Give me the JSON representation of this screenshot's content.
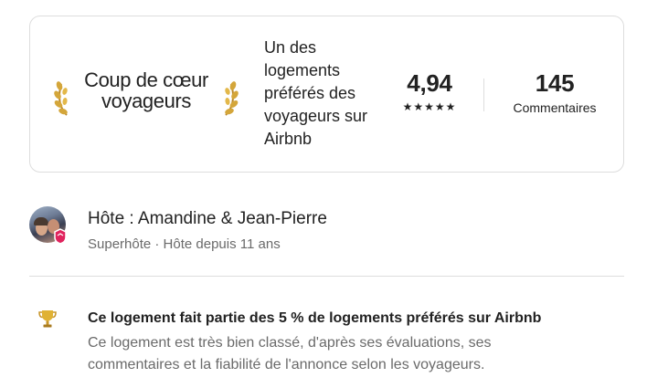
{
  "guest_favorite": {
    "badge_title": "Coup de cœur voyageurs",
    "description": "Un des logements préférés des voyageurs sur Airbnb",
    "rating": "4,94",
    "stars": "★★★★★",
    "reviews_count": "145",
    "reviews_label": "Commentaires"
  },
  "host": {
    "name": "Hôte : Amandine & Jean-Pierre",
    "subtitle": "Superhôte · Hôte depuis 11 ans"
  },
  "highlight": {
    "icon": "trophy-icon",
    "title": "Ce logement fait partie des 5 % de logements préférés sur Airbnb",
    "description": "Ce logement est très bien classé, d'après ses évaluations, ses commentaires et la fiabilité de l'annonce selon les voyageurs."
  },
  "colors": {
    "text_primary": "#222222",
    "text_secondary": "#6a6a6a",
    "border": "#dddddd",
    "laurel_gold": "#c99a2e",
    "superhost_pink": "#e0245e"
  }
}
